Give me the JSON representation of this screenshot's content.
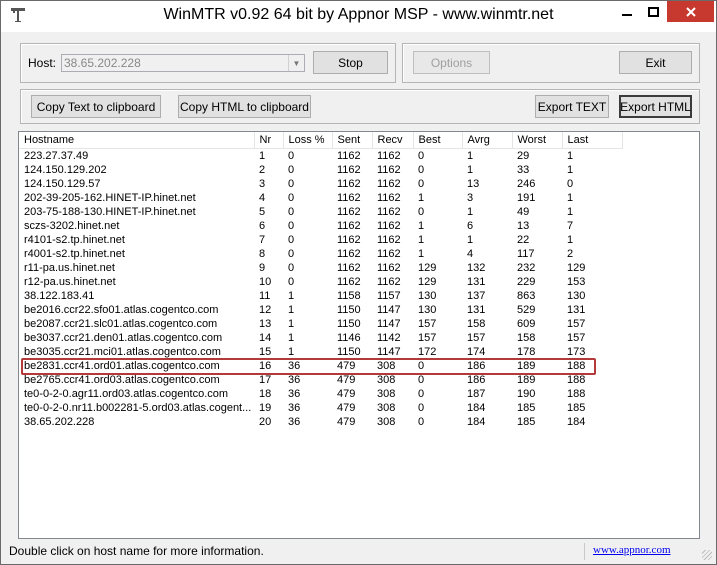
{
  "window": {
    "title": "WinMTR v0.92 64 bit by Appnor MSP - www.winmtr.net"
  },
  "host": {
    "label": "Host:",
    "value": "38.65.202.228"
  },
  "buttons": {
    "stop": "Stop",
    "options": "Options",
    "exit": "Exit",
    "copy_text": "Copy Text to clipboard",
    "copy_html": "Copy HTML to clipboard",
    "export_text": "Export TEXT",
    "export_html": "Export HTML"
  },
  "table": {
    "columns": [
      "Hostname",
      "Nr",
      "Loss %",
      "Sent",
      "Recv",
      "Best",
      "Avrg",
      "Worst",
      "Last"
    ],
    "rows": [
      [
        "223.27.37.49",
        "1",
        "0",
        "1162",
        "1162",
        "0",
        "1",
        "29",
        "1"
      ],
      [
        "124.150.129.202",
        "2",
        "0",
        "1162",
        "1162",
        "0",
        "1",
        "33",
        "1"
      ],
      [
        "124.150.129.57",
        "3",
        "0",
        "1162",
        "1162",
        "0",
        "13",
        "246",
        "0"
      ],
      [
        "202-39-205-162.HINET-IP.hinet.net",
        "4",
        "0",
        "1162",
        "1162",
        "1",
        "3",
        "191",
        "1"
      ],
      [
        "203-75-188-130.HINET-IP.hinet.net",
        "5",
        "0",
        "1162",
        "1162",
        "0",
        "1",
        "49",
        "1"
      ],
      [
        "sczs-3202.hinet.net",
        "6",
        "0",
        "1162",
        "1162",
        "1",
        "6",
        "13",
        "7"
      ],
      [
        "r4101-s2.tp.hinet.net",
        "7",
        "0",
        "1162",
        "1162",
        "1",
        "1",
        "22",
        "1"
      ],
      [
        "r4001-s2.tp.hinet.net",
        "8",
        "0",
        "1162",
        "1162",
        "1",
        "4",
        "117",
        "2"
      ],
      [
        "r11-pa.us.hinet.net",
        "9",
        "0",
        "1162",
        "1162",
        "129",
        "132",
        "232",
        "129"
      ],
      [
        "r12-pa.us.hinet.net",
        "10",
        "0",
        "1162",
        "1162",
        "129",
        "131",
        "229",
        "153"
      ],
      [
        "38.122.183.41",
        "11",
        "1",
        "1158",
        "1157",
        "130",
        "137",
        "863",
        "130"
      ],
      [
        "be2016.ccr22.sfo01.atlas.cogentco.com",
        "12",
        "1",
        "1150",
        "1147",
        "130",
        "131",
        "529",
        "131"
      ],
      [
        "be2087.ccr21.slc01.atlas.cogentco.com",
        "13",
        "1",
        "1150",
        "1147",
        "157",
        "158",
        "609",
        "157"
      ],
      [
        "be3037.ccr21.den01.atlas.cogentco.com",
        "14",
        "1",
        "1146",
        "1142",
        "157",
        "157",
        "158",
        "157"
      ],
      [
        "be3035.ccr21.mci01.atlas.cogentco.com",
        "15",
        "1",
        "1150",
        "1147",
        "172",
        "174",
        "178",
        "173"
      ],
      [
        "be2831.ccr41.ord01.atlas.cogentco.com",
        "16",
        "36",
        "479",
        "308",
        "0",
        "186",
        "189",
        "188"
      ],
      [
        "be2765.ccr41.ord03.atlas.cogentco.com",
        "17",
        "36",
        "479",
        "308",
        "0",
        "186",
        "189",
        "188"
      ],
      [
        "te0-0-2-0.agr11.ord03.atlas.cogentco.com",
        "18",
        "36",
        "479",
        "308",
        "0",
        "187",
        "190",
        "188"
      ],
      [
        "te0-0-2-0.nr11.b002281-5.ord03.atlas.cogent...",
        "19",
        "36",
        "479",
        "308",
        "0",
        "184",
        "185",
        "185"
      ],
      [
        "38.65.202.228",
        "20",
        "36",
        "479",
        "308",
        "0",
        "184",
        "185",
        "184"
      ]
    ]
  },
  "status": {
    "message": "Double click on host name for more information.",
    "link": "www.appnor.com"
  },
  "icons": {
    "app": "winmtr-app-icon",
    "minimize": "minimize-icon",
    "maximize": "maximize-icon",
    "close": "close-icon"
  },
  "colors": {
    "close_button": "#c7392f",
    "highlight_border": "#b33a3a",
    "link": "#0000ee"
  }
}
